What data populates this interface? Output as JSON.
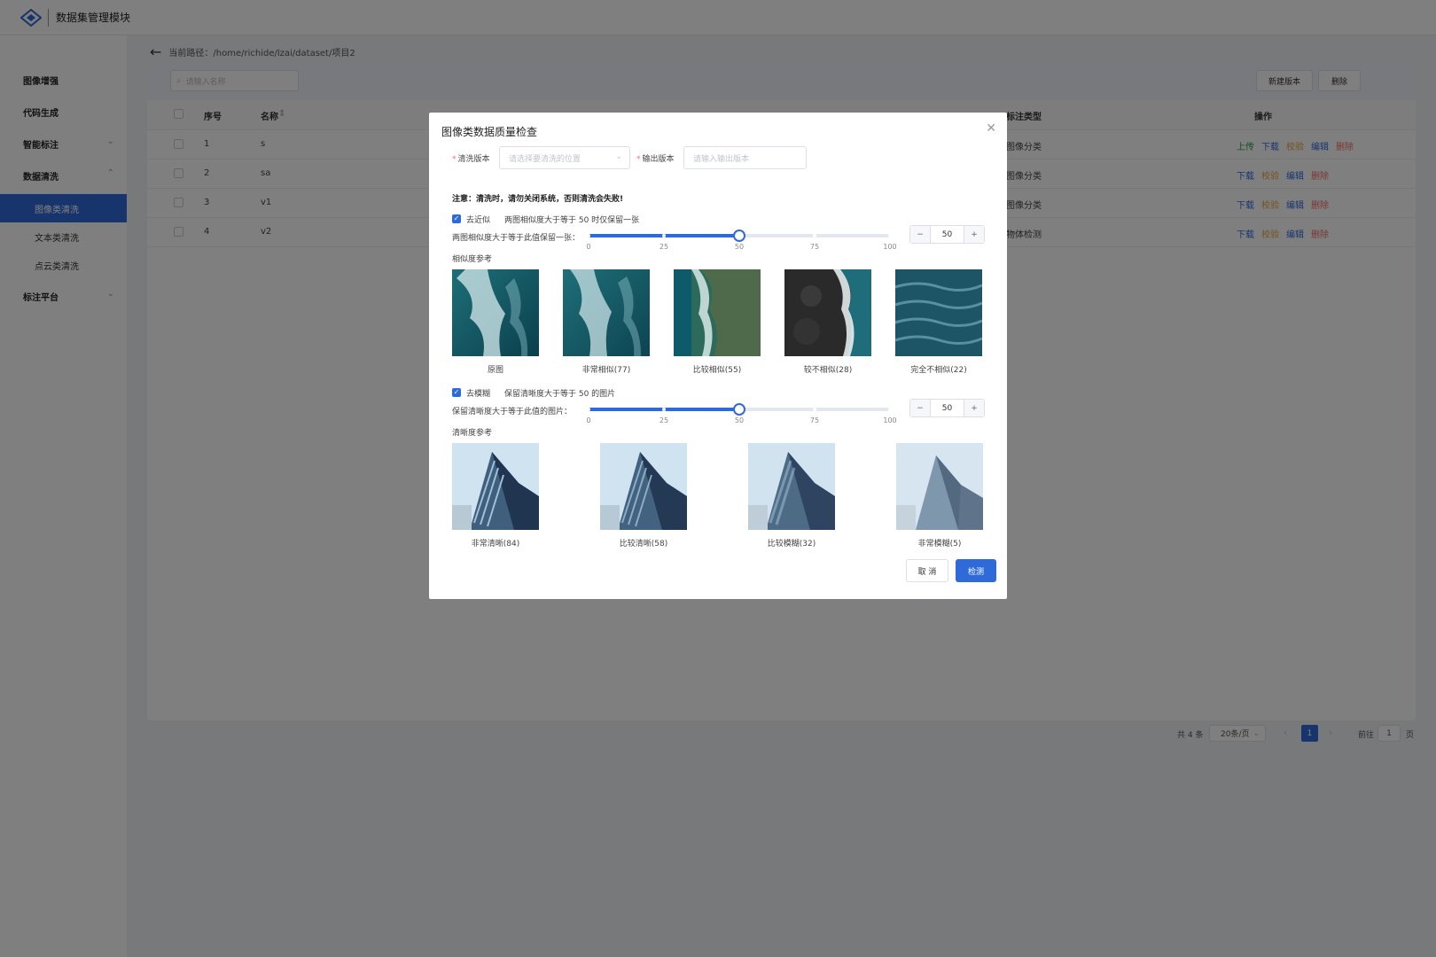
{
  "header": {
    "title": "数据集管理模块"
  },
  "sidebar": {
    "items": [
      {
        "label": "图像增强"
      },
      {
        "label": "代码生成"
      },
      {
        "label": "智能标注",
        "chevron": "down"
      },
      {
        "label": "数据清洗",
        "chevron": "up"
      },
      {
        "label": "标注平台",
        "chevron": "down"
      }
    ],
    "subitems": [
      {
        "label": "图像类清洗",
        "active": true
      },
      {
        "label": "文本类清洗"
      },
      {
        "label": "点云类清洗"
      }
    ]
  },
  "breadcrumb": {
    "label": "当前路径：",
    "path": "/home/richide/lzai/dataset/项目2"
  },
  "toolbar": {
    "search_placeholder": "请输入名称",
    "new_version": "新建版本",
    "delete": "删除"
  },
  "table": {
    "headers": {
      "index": "序号",
      "name": "名称",
      "label_type": "标注类型",
      "ops": "操作"
    },
    "rows": [
      {
        "index": "1",
        "name": "s",
        "label_type": "图像分类",
        "ops": [
          "上传",
          "下载",
          "校验",
          "编辑",
          "删除"
        ]
      },
      {
        "index": "2",
        "name": "sa",
        "label_type": "图像分类",
        "ops": [
          "下载",
          "校验",
          "编辑",
          "删除"
        ]
      },
      {
        "index": "3",
        "name": "v1",
        "label_type": "图像分类",
        "ops": [
          "下载",
          "校验",
          "编辑",
          "删除"
        ]
      },
      {
        "index": "4",
        "name": "v2",
        "label_type": "物体检测",
        "ops": [
          "下载",
          "校验",
          "编辑",
          "删除"
        ]
      }
    ]
  },
  "pagination": {
    "total": "共 4 条",
    "page_size": "20条/页",
    "current": "1",
    "goto_label": "前往",
    "goto_value": "1",
    "page_unit": "页"
  },
  "dialog": {
    "title": "图像类数据质量检查",
    "clean_version_label": "清洗版本",
    "clean_version_placeholder": "请选择要清洗的位置",
    "output_version_label": "输出版本",
    "output_version_placeholder": "请输入输出版本",
    "note": "注意：清洗时，请勿关闭系统，否则清洗会失败!",
    "dedup": {
      "checkbox_label": "去近似",
      "hint": "两图相似度大于等于 50 时仅保留一张",
      "slider_label": "两图相似度大于等于此值保留一张：",
      "value": 50,
      "value_text": "50",
      "ticks": [
        "0",
        "25",
        "50",
        "75",
        "100"
      ],
      "ref_label": "相似度参考",
      "refs": [
        {
          "caption": "原图"
        },
        {
          "caption": "非常相似(77)"
        },
        {
          "caption": "比较相似(55)"
        },
        {
          "caption": "较不相似(28)"
        },
        {
          "caption": "完全不相似(22)"
        }
      ]
    },
    "deblur": {
      "checkbox_label": "去模糊",
      "hint": "保留清晰度大于等于 50 的图片",
      "slider_label": "保留清晰度大于等于此值的图片：",
      "value": 50,
      "value_text": "50",
      "ticks": [
        "0",
        "25",
        "50",
        "75",
        "100"
      ],
      "ref_label": "清晰度参考",
      "refs": [
        {
          "caption": "非常清晰(84)"
        },
        {
          "caption": "比较清晰(58)"
        },
        {
          "caption": "比较模糊(32)"
        },
        {
          "caption": "非常模糊(5)"
        }
      ]
    },
    "cancel": "取 消",
    "detect": "检测"
  },
  "colors": {
    "primary": "#2f6bd8",
    "upload": "#27a147",
    "verify": "#e6a23c",
    "delete": "#f56c6c"
  }
}
